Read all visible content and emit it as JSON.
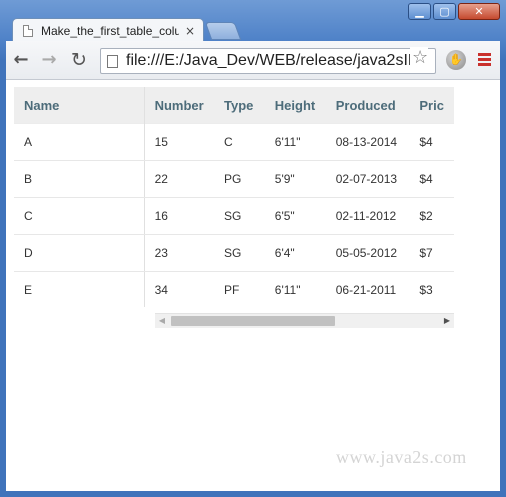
{
  "window": {
    "controls": {
      "minimize": "▁",
      "maximize": "▢",
      "close": "✕"
    }
  },
  "tab": {
    "title": "Make_the_first_table_colu",
    "close": "×"
  },
  "toolbar": {
    "back": "←",
    "forward": "→",
    "reload": "↻",
    "address": "file:///E:/Java_Dev/WEB/release/java2sID",
    "star": "☆",
    "extension": "✋"
  },
  "table": {
    "headers": [
      "Name",
      "Number",
      "Type",
      "Height",
      "Produced",
      "Pric"
    ],
    "rows": [
      [
        "A",
        "15",
        "C",
        "6'11\"",
        "08-13-2014",
        "$4"
      ],
      [
        "B",
        "22",
        "PG",
        "5'9\"",
        "02-07-2013",
        "$4"
      ],
      [
        "C",
        "16",
        "SG",
        "6'5\"",
        "02-11-2012",
        "$2"
      ],
      [
        "D",
        "23",
        "SG",
        "6'4\"",
        "05-05-2012",
        "$7"
      ],
      [
        "E",
        "34",
        "PF",
        "6'11\"",
        "06-21-2011",
        "$3"
      ]
    ]
  },
  "scrollbar": {
    "left_arrow": "◀",
    "right_arrow": "▶",
    "position": 0.0
  },
  "watermark": "www.java2s.com"
}
